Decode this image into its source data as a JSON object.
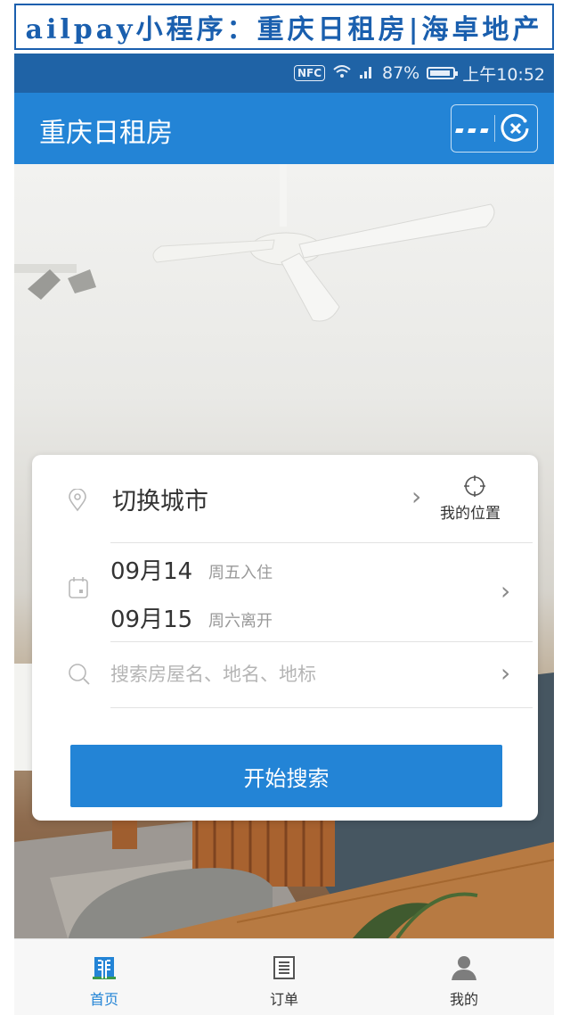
{
  "banner": {
    "text": "ailpay小程序：重庆日租房|海卓地产"
  },
  "status_bar": {
    "nfc": "NFC",
    "battery": "87%",
    "time": "上午10:52"
  },
  "nav": {
    "title": "重庆日租房",
    "more_icon": "more-dots-icon",
    "close_icon": "close-circle-icon"
  },
  "card": {
    "city": {
      "label": "切换城市",
      "my_location": "我的位置"
    },
    "dates": {
      "checkin_date": "09月14",
      "checkin_note": "周五入住",
      "checkout_date": "09月15",
      "checkout_note": "周六离开"
    },
    "search": {
      "placeholder": "搜索房屋名、地名、地标"
    },
    "search_button": "开始搜索"
  },
  "tabs": [
    {
      "label": "首页",
      "icon": "building-icon",
      "active": true
    },
    {
      "label": "订单",
      "icon": "list-icon",
      "active": false
    },
    {
      "label": "我的",
      "icon": "person-icon",
      "active": false
    }
  ],
  "colors": {
    "accent": "#2384d6",
    "status_bar": "#1f63a6",
    "banner": "#1a5fae"
  }
}
